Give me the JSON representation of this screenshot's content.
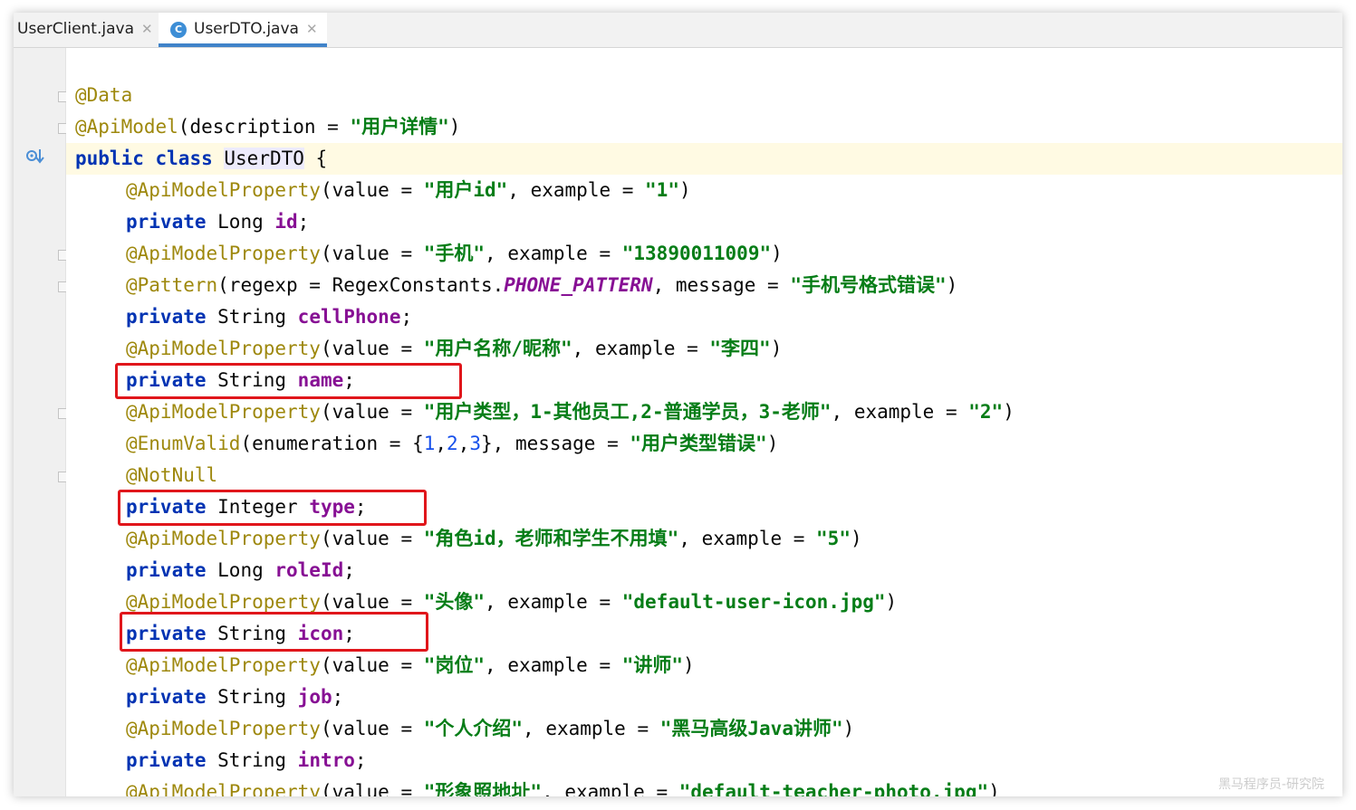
{
  "tabs": [
    {
      "label": "UserClient.java",
      "active": false
    },
    {
      "label": "UserDTO.java",
      "active": true,
      "icon_letter": "C"
    }
  ],
  "tab_close_glyph": "✕",
  "gutter_icons": [
    "implementation-down-arrow-icon"
  ],
  "colors": {
    "annotation": "#9e880d",
    "keyword": "#0033b3",
    "string": "#067d17",
    "field": "#871094",
    "number": "#1750eb",
    "highlight_box": "#e0161b",
    "caret_row": "#fffae3",
    "active_tab_underline": "#4083c9"
  },
  "code": {
    "l1": {
      "ann": "@Data"
    },
    "l2": {
      "ann": "@ApiModel",
      "p1": "(description = ",
      "s1": "\"用户详情\"",
      "p2": ")"
    },
    "l3": {
      "kw1": "public",
      "kw2": "class",
      "cls": "UserDTO",
      "p1": " {"
    },
    "l4": {
      "ann": "@ApiModelProperty",
      "p1": "(value = ",
      "s1": "\"用户id\"",
      "p2": ", example = ",
      "s2": "\"1\"",
      "p3": ")"
    },
    "l5": {
      "kw": "private",
      "type": " Long ",
      "fld": "id",
      "p1": ";"
    },
    "l6": {
      "ann": "@ApiModelProperty",
      "p1": "(value = ",
      "s1": "\"手机\"",
      "p2": ", example = ",
      "s2": "\"13890011009\"",
      "p3": ")"
    },
    "l7": {
      "ann": "@Pattern",
      "p1": "(regexp = RegexConstants.",
      "const": "PHONE_PATTERN",
      "p2": ", message = ",
      "s1": "\"手机号格式错误\"",
      "p3": ")"
    },
    "l8": {
      "kw": "private",
      "type": " String ",
      "fld": "cellPhone",
      "p1": ";"
    },
    "l9": {
      "ann": "@ApiModelProperty",
      "p1": "(value = ",
      "s1": "\"用户名称/昵称\"",
      "p2": ", example = ",
      "s2": "\"李四\"",
      "p3": ")"
    },
    "l10": {
      "kw": "private",
      "type": " String ",
      "fld": "name",
      "p1": ";"
    },
    "l11": {
      "ann": "@ApiModelProperty",
      "p1": "(value = ",
      "s1": "\"用户类型，1-其他员工,2-普通学员，3-老师\"",
      "p2": ", example = ",
      "s2": "\"2\"",
      "p3": ")"
    },
    "l12": {
      "ann": "@EnumValid",
      "p1": "(enumeration = {",
      "n1": "1",
      "c1": ",",
      "n2": "2",
      "c2": ",",
      "n3": "3",
      "p2": "}, message = ",
      "s1": "\"用户类型错误\"",
      "p3": ")"
    },
    "l13": {
      "ann": "@NotNull"
    },
    "l14": {
      "kw": "private",
      "type": " Integer ",
      "fld": "type",
      "p1": ";"
    },
    "l15": {
      "ann": "@ApiModelProperty",
      "p1": "(value = ",
      "s1": "\"角色id，老师和学生不用填\"",
      "p2": ", example = ",
      "s2": "\"5\"",
      "p3": ")"
    },
    "l16": {
      "kw": "private",
      "type": " Long ",
      "fld": "roleId",
      "p1": ";"
    },
    "l17": {
      "ann": "@ApiModelProperty",
      "p1": "(value = ",
      "s1": "\"头像\"",
      "p2": ", example = ",
      "s2": "\"default-user-icon.jpg\"",
      "p3": ")"
    },
    "l18": {
      "kw": "private",
      "type": " String ",
      "fld": "icon",
      "p1": ";"
    },
    "l19": {
      "ann": "@ApiModelProperty",
      "p1": "(value = ",
      "s1": "\"岗位\"",
      "p2": ", example = ",
      "s2": "\"讲师\"",
      "p3": ")"
    },
    "l20": {
      "kw": "private",
      "type": " String ",
      "fld": "job",
      "p1": ";"
    },
    "l21": {
      "ann": "@ApiModelProperty",
      "p1": "(value = ",
      "s1": "\"个人介绍\"",
      "p2": ", example = ",
      "s2": "\"黑马高级Java讲师\"",
      "p3": ")"
    },
    "l22": {
      "kw": "private",
      "type": " String ",
      "fld": "intro",
      "p1": ";"
    },
    "l23": {
      "ann": "@ApiModelProperty",
      "p1": "(value = ",
      "s1": "\"形象照地址\"",
      "p2": ", example = ",
      "s2": "\"default-teacher-photo.jpg\"",
      "p3": ")"
    }
  },
  "watermark": "黑马程序员-研究院"
}
